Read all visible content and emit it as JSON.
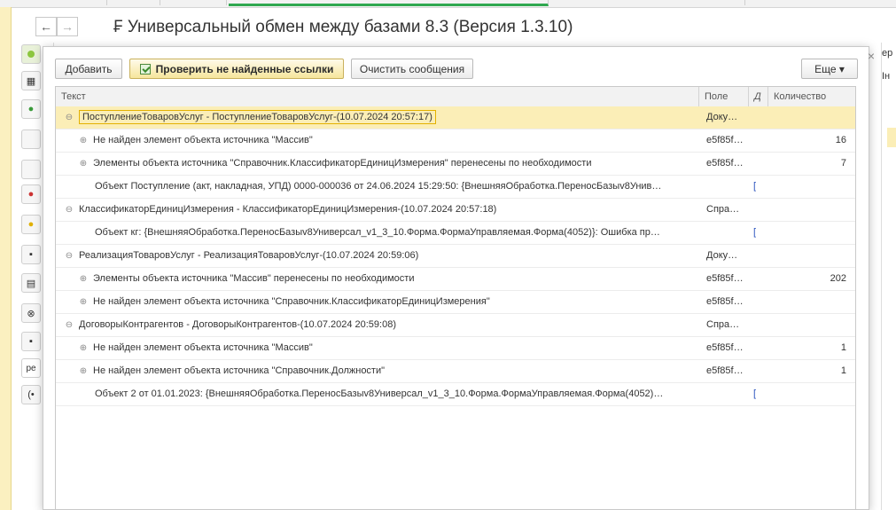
{
  "window": {
    "title": "₣ Универсальный обмен между базами 8.3 (Версия 1.3.10)",
    "back_icon": "arrow-left-icon",
    "forward_icon": "arrow-right-icon"
  },
  "background": {
    "right_fragments": [
      "ер",
      "Ін"
    ],
    "left_text_fragment": "ре"
  },
  "toolbar": {
    "add_label": "Добавить",
    "check_links_label": "Проверить не найденные ссылки",
    "clear_messages_label": "Очистить сообщения",
    "more_label": "Еще ▾"
  },
  "grid": {
    "columns": [
      "Текст",
      "Поле",
      "Д",
      "Количество"
    ],
    "rows": [
      {
        "text": "ПоступлениеТоваровУслуг - ПоступлениеТоваровУслуг-(10.07.2024 20:57:17)",
        "field": "Доку…",
        "link": "",
        "qty": ""
      },
      {
        "text": "Не найден элемент объекта источника \"Массив\"",
        "field": "e5f85f…",
        "link": "",
        "qty": "16"
      },
      {
        "text": "Элементы объекта источника \"Справочник.КлассификаторЕдиницИзмерения\" перенесены по необходимости",
        "field": "e5f85f…",
        "link": "",
        "qty": "7"
      },
      {
        "text": "Объект Поступление (акт, накладная, УПД) 0000-000036 от 24.06.2024 15:29:50: {ВнешняяОбработка.ПереносБазыv8Унив…",
        "field": "",
        "link": "[",
        "qty": ""
      },
      {
        "text": "КлассификаторЕдиницИзмерения - КлассификаторЕдиницИзмерения-(10.07.2024 20:57:18)",
        "field": "Спра…",
        "link": "",
        "qty": ""
      },
      {
        "text": "Объект кг: {ВнешняяОбработка.ПереносБазыv8Универсал_v1_3_10.Форма.ФормаУправляемая.Форма(4052)}: Ошибка пр…",
        "field": "",
        "link": "[",
        "qty": ""
      },
      {
        "text": "РеализацияТоваровУслуг - РеализацияТоваровУслуг-(10.07.2024 20:59:06)",
        "field": "Доку…",
        "link": "",
        "qty": ""
      },
      {
        "text": "Элементы объекта источника \"Массив\" перенесены по необходимости",
        "field": "e5f85f…",
        "link": "",
        "qty": "202"
      },
      {
        "text": "Не найден элемент объекта источника \"Справочник.КлассификаторЕдиницИзмерения\"",
        "field": "e5f85f…",
        "link": "",
        "qty": ""
      },
      {
        "text": "ДоговорыКонтрагентов - ДоговорыКонтрагентов-(10.07.2024 20:59:08)",
        "field": "Спра…",
        "link": "",
        "qty": ""
      },
      {
        "text": "Не найден элемент объекта источника \"Массив\"",
        "field": "e5f85f…",
        "link": "",
        "qty": "1"
      },
      {
        "text": "Не найден элемент объекта источника \"Справочник.Должности\"",
        "field": "e5f85f…",
        "link": "",
        "qty": "1"
      },
      {
        "text": "Объект 2 от 01.01.2023: {ВнешняяОбработка.ПереносБазыv8Универсал_v1_3_10.Форма.ФормаУправляемая.Форма(4052)…",
        "field": "",
        "link": "[",
        "qty": ""
      }
    ]
  },
  "colors": {
    "selected_row": "#fbeeb7",
    "primary_button": "#f6e69c",
    "link": "#2a52be"
  }
}
